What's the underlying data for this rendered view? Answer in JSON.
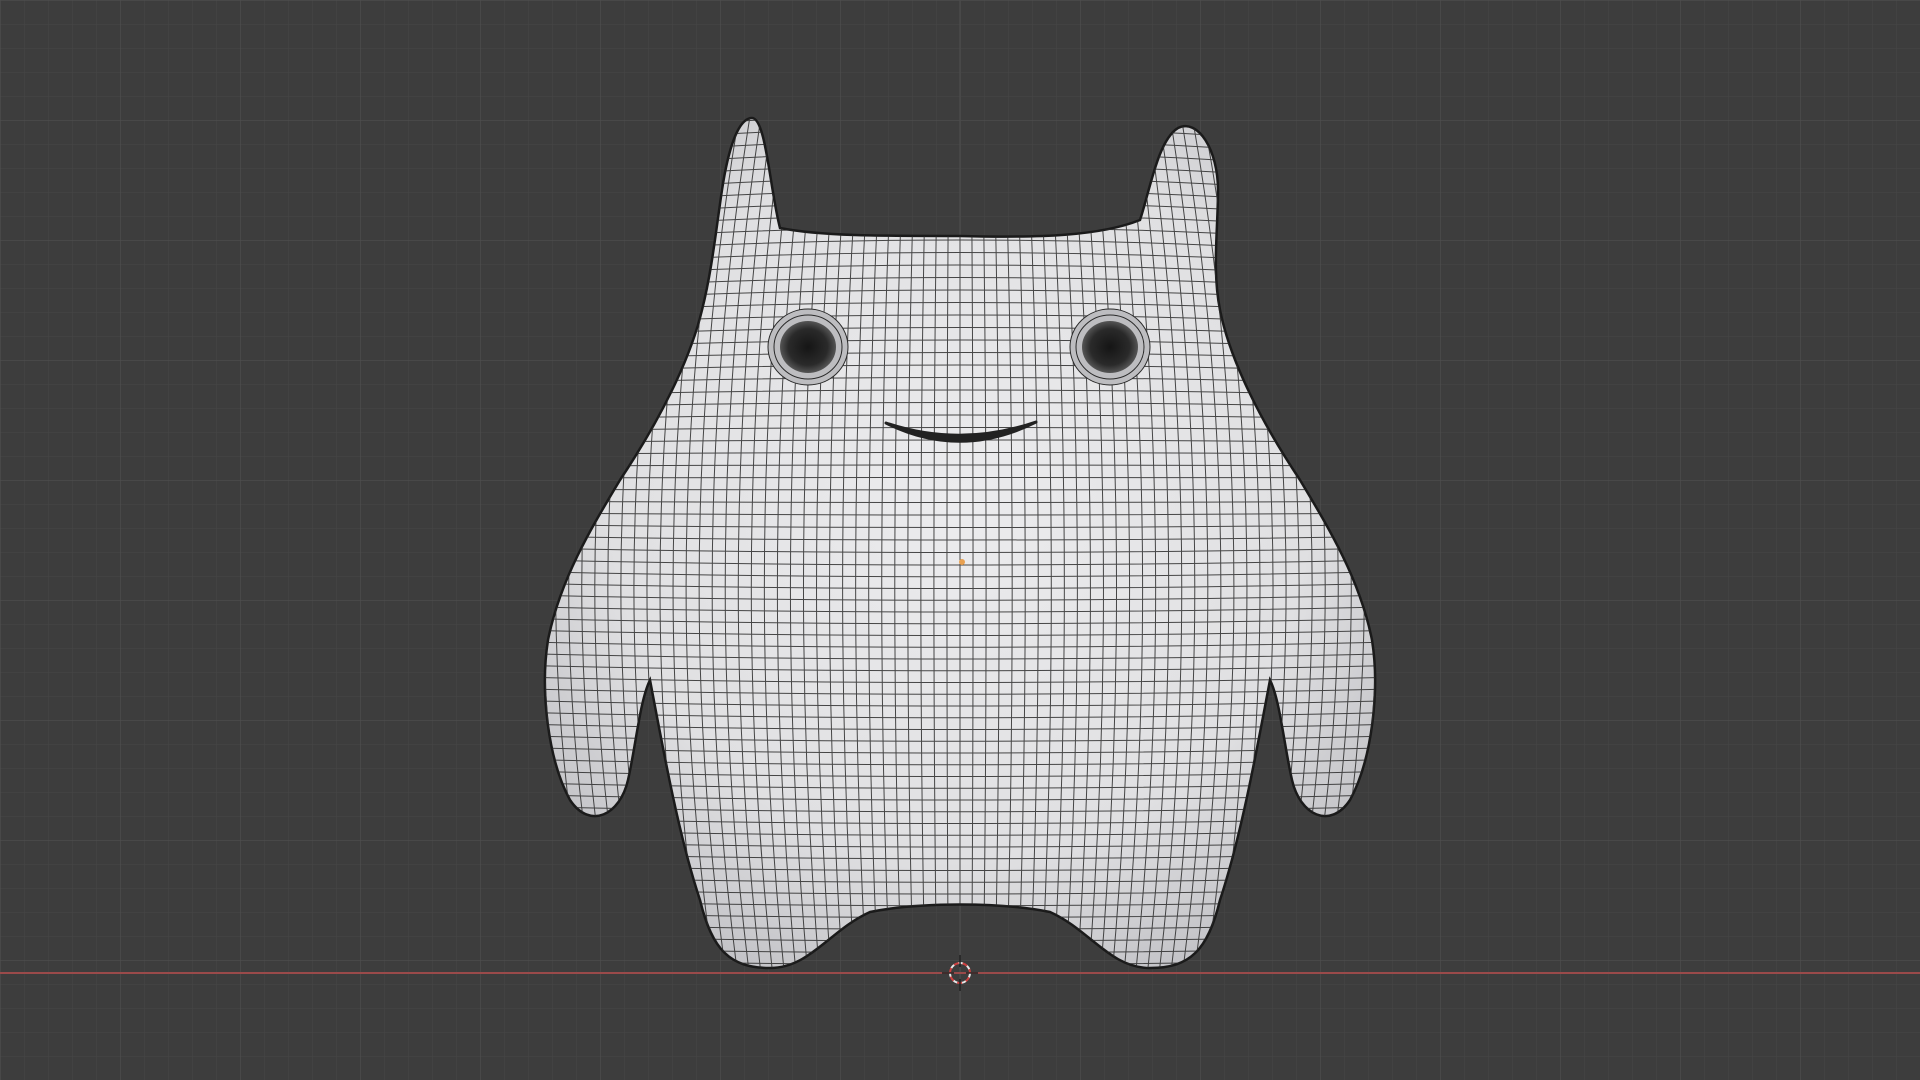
{
  "viewport": {
    "name": "3d-viewport",
    "view": "front-orthographic",
    "overlays": {
      "grid": true,
      "x_axis_line": true,
      "wireframe": true
    },
    "colors": {
      "background": "#3d3d3d",
      "grid_minor": "#474747",
      "grid_major": "#4f4f4f",
      "x_axis": "#9a4a4a",
      "mesh_fill": "#e2e2e4",
      "mesh_shade": "#c8c8cc",
      "wire": "#2a2a2a",
      "eyes": "#1e1e1e",
      "mouth": "#222222",
      "origin": "#e8a050"
    }
  },
  "scene": {
    "object": "creature-mesh",
    "features": [
      "left-horn",
      "right-horn",
      "left-eye",
      "right-eye",
      "mouth",
      "left-arm",
      "right-arm",
      "left-foot",
      "right-foot"
    ]
  }
}
